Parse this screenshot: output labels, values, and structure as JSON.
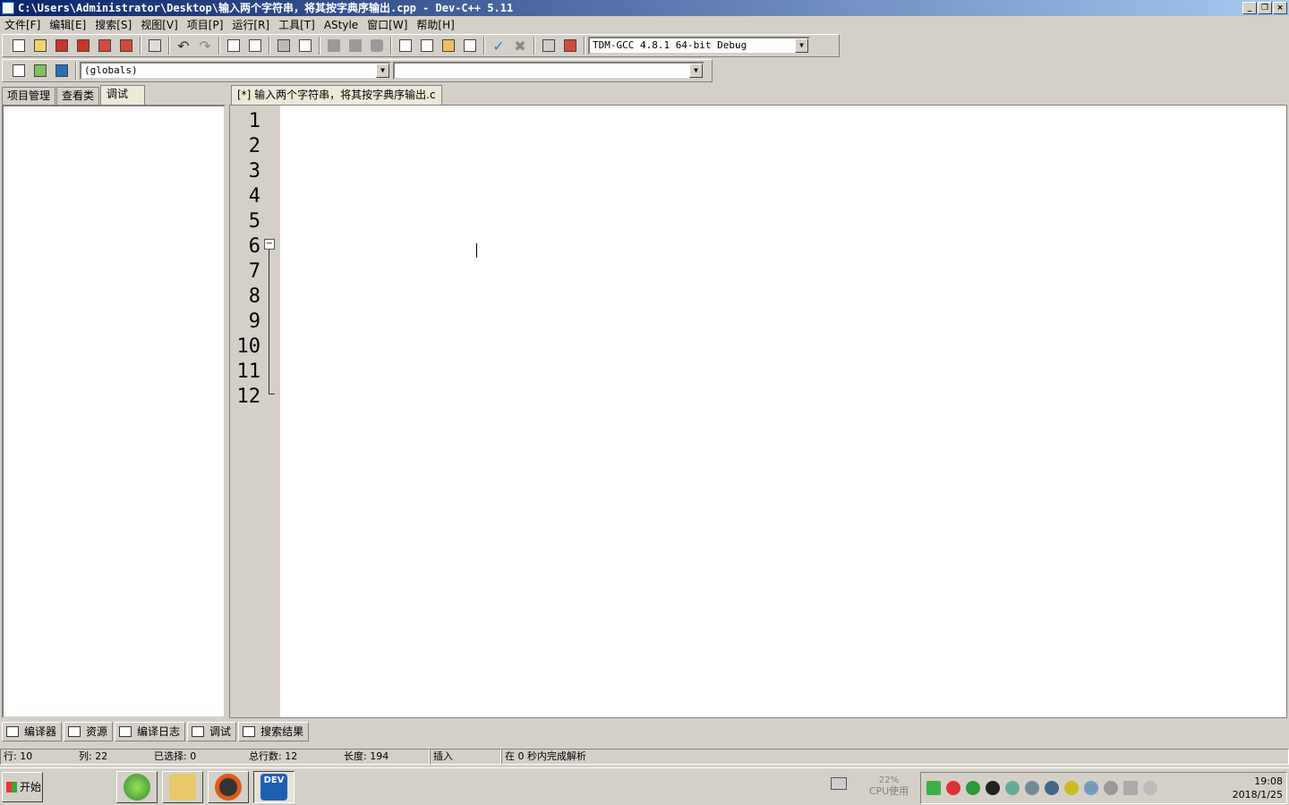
{
  "window": {
    "title": "C:\\Users\\Administrator\\Desktop\\输入两个字符串，将其按字典序输出.cpp - Dev-C++ 5.11"
  },
  "menu": [
    "文件[F]",
    "编辑[E]",
    "搜索[S]",
    "视图[V]",
    "项目[P]",
    "运行[R]",
    "工具[T]",
    "AStyle",
    "窗口[W]",
    "帮助[H]"
  ],
  "toolbar": {
    "compiler_select": "TDM-GCC 4.8.1 64-bit Debug",
    "scope_select": "(globals)",
    "function_select": ""
  },
  "left_tabs": [
    "项目管理",
    "查看类",
    "调试"
  ],
  "editor": {
    "tab_label": "[*] 输入两个字符串，将其按字典序输出.c",
    "line_numbers": [
      "1",
      "2",
      "3",
      "4",
      "5",
      "6",
      "7",
      "8",
      "9",
      "10",
      "11",
      "12"
    ],
    "highlighted_line": 10
  },
  "bottom_tabs": [
    "编译器",
    "资源",
    "编译日志",
    "调试",
    "搜索结果"
  ],
  "status": {
    "row": "行: 10",
    "col": "列: 22",
    "selected": "已选择: 0",
    "total_lines": "总行数: 12",
    "length": "长度: 194",
    "mode": "插入",
    "parse": "在 0 秒内完成解析"
  },
  "taskbar": {
    "start_label": "开始",
    "cpu_percent": "22%",
    "cpu_label": "CPU使用",
    "time": "19:08",
    "date": "2018/1/25",
    "dev_icon_label": "DEV"
  },
  "colors": {
    "line_highlight": "#c4f2f8",
    "bracket_match": "#e82c1f",
    "comment": "#1a3d8f",
    "number": "#7a2d9c",
    "operator": "#b00000"
  }
}
